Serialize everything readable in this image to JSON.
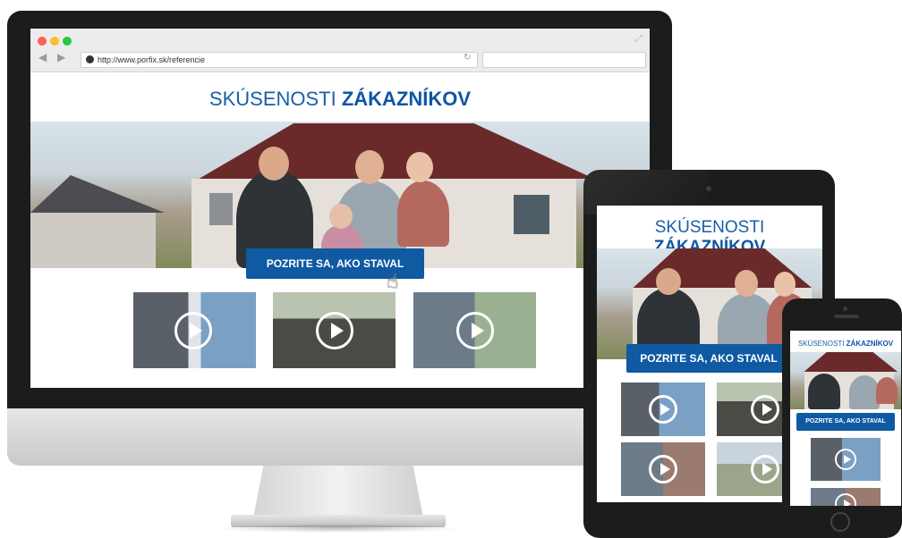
{
  "browser": {
    "url": "http://www.porfix.sk/referencie",
    "nav_back_icon": "chevron-left-icon",
    "nav_forward_icon": "chevron-right-icon",
    "reload_icon": "reload-icon"
  },
  "page": {
    "title_light": "SKÚSENOSTI ",
    "title_bold": "ZÁKAZNÍKOV",
    "cta_label": "POZRITE SA, AKO STAVAL"
  },
  "colors": {
    "brand_blue": "#0f5aa3",
    "title_blue": "#1a5fa6",
    "traffic_red": "#ff5f57",
    "traffic_yellow": "#febc2e",
    "traffic_green": "#28c840"
  }
}
